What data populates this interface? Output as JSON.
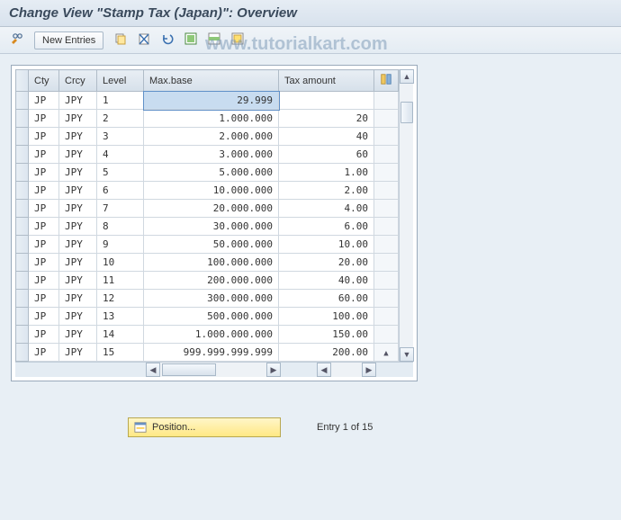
{
  "header": {
    "title": "Change View \"Stamp Tax (Japan)\": Overview"
  },
  "toolbar": {
    "new_entries_label": "New Entries"
  },
  "watermark": "www.tutorialkart.com",
  "table": {
    "columns": {
      "cty": "Cty",
      "crcy": "Crcy",
      "level": "Level",
      "maxbase": "Max.base",
      "taxamt": "Tax amount"
    },
    "rows": [
      {
        "cty": "JP",
        "crcy": "JPY",
        "level": "1",
        "maxbase": "29.999",
        "taxamt": ""
      },
      {
        "cty": "JP",
        "crcy": "JPY",
        "level": "2",
        "maxbase": "1.000.000",
        "taxamt": "20"
      },
      {
        "cty": "JP",
        "crcy": "JPY",
        "level": "3",
        "maxbase": "2.000.000",
        "taxamt": "40"
      },
      {
        "cty": "JP",
        "crcy": "JPY",
        "level": "4",
        "maxbase": "3.000.000",
        "taxamt": "60"
      },
      {
        "cty": "JP",
        "crcy": "JPY",
        "level": "5",
        "maxbase": "5.000.000",
        "taxamt": "1.00"
      },
      {
        "cty": "JP",
        "crcy": "JPY",
        "level": "6",
        "maxbase": "10.000.000",
        "taxamt": "2.00"
      },
      {
        "cty": "JP",
        "crcy": "JPY",
        "level": "7",
        "maxbase": "20.000.000",
        "taxamt": "4.00"
      },
      {
        "cty": "JP",
        "crcy": "JPY",
        "level": "8",
        "maxbase": "30.000.000",
        "taxamt": "6.00"
      },
      {
        "cty": "JP",
        "crcy": "JPY",
        "level": "9",
        "maxbase": "50.000.000",
        "taxamt": "10.00"
      },
      {
        "cty": "JP",
        "crcy": "JPY",
        "level": "10",
        "maxbase": "100.000.000",
        "taxamt": "20.00"
      },
      {
        "cty": "JP",
        "crcy": "JPY",
        "level": "11",
        "maxbase": "200.000.000",
        "taxamt": "40.00"
      },
      {
        "cty": "JP",
        "crcy": "JPY",
        "level": "12",
        "maxbase": "300.000.000",
        "taxamt": "60.00"
      },
      {
        "cty": "JP",
        "crcy": "JPY",
        "level": "13",
        "maxbase": "500.000.000",
        "taxamt": "100.00"
      },
      {
        "cty": "JP",
        "crcy": "JPY",
        "level": "14",
        "maxbase": "1.000.000.000",
        "taxamt": "150.00"
      },
      {
        "cty": "JP",
        "crcy": "JPY",
        "level": "15",
        "maxbase": "999.999.999.999",
        "taxamt": "200.00"
      }
    ]
  },
  "footer": {
    "position_label": "Position...",
    "entry_status": "Entry 1 of 15"
  }
}
